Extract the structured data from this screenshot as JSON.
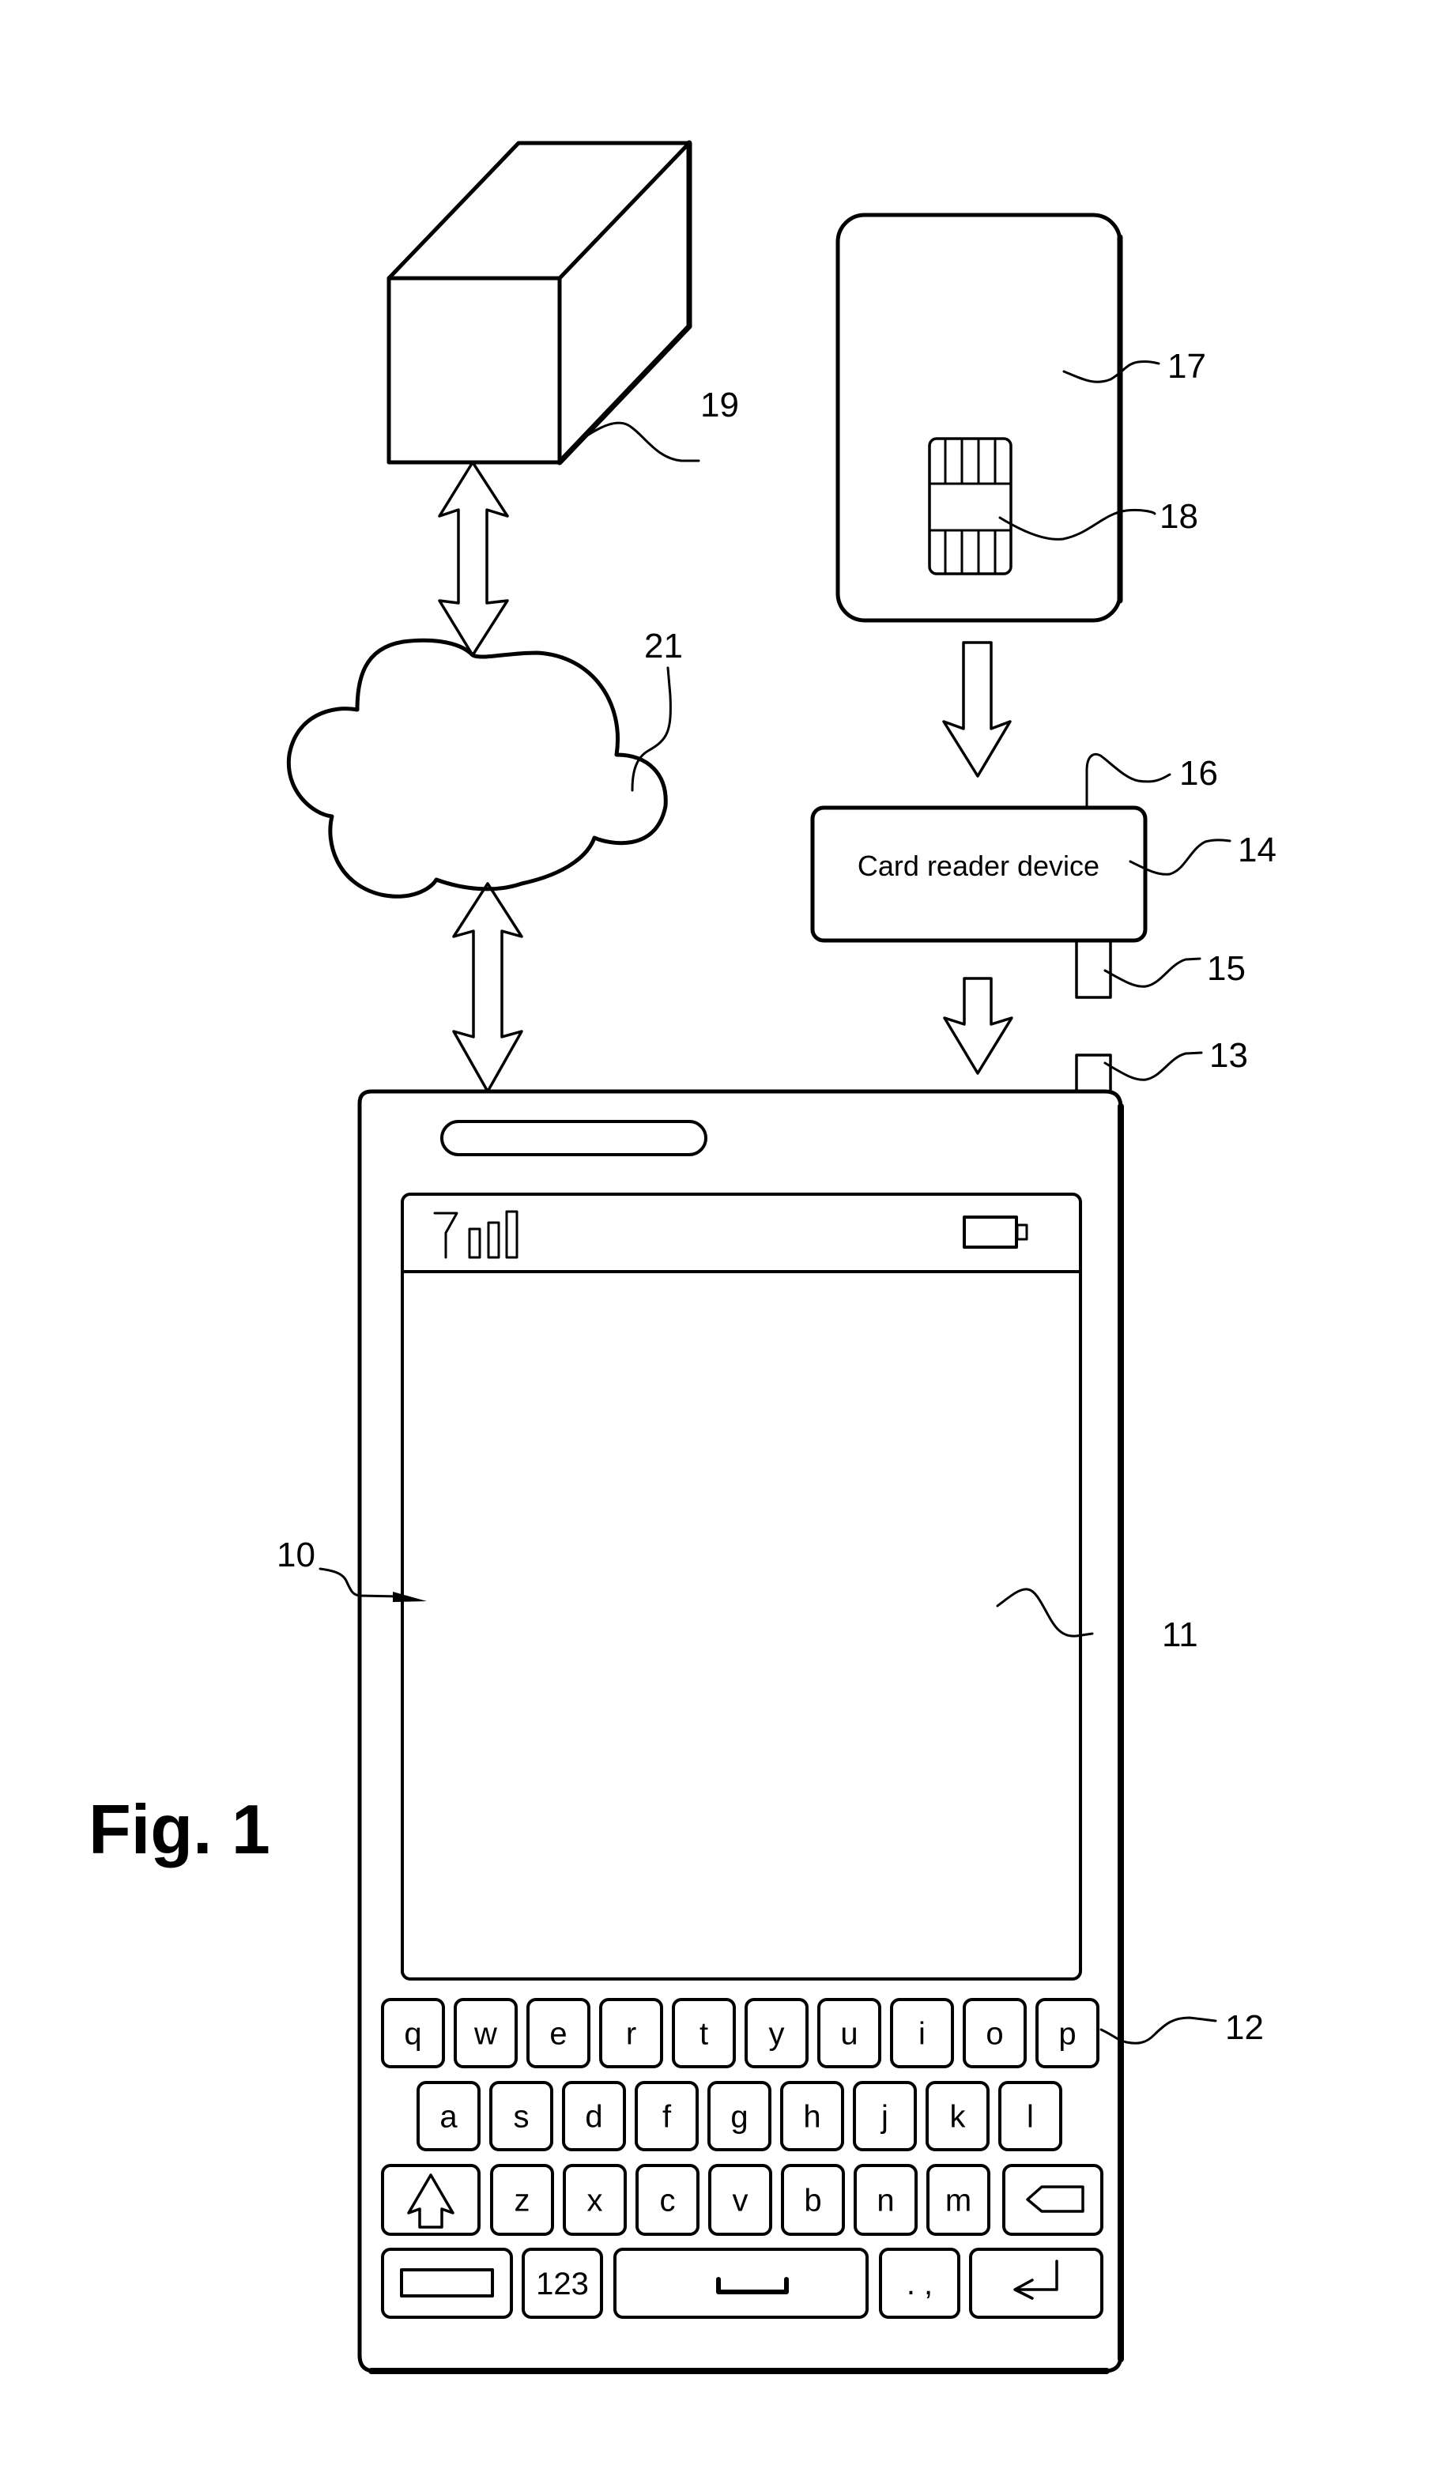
{
  "figure": {
    "title": "Fig. 1",
    "description": "Patent drawing: server, network cloud, chip card, card reader device and mobile phone with on-screen keyboard"
  },
  "components": {
    "server": {
      "ref": "19"
    },
    "network": {
      "ref": "21"
    },
    "chip_card": {
      "ref": "17"
    },
    "chip": {
      "ref": "18"
    },
    "card_reader": {
      "ref": "14",
      "label": "Card reader device"
    },
    "reader_antenna": {
      "ref": "16"
    },
    "reader_connector": {
      "ref": "15"
    },
    "phone_port": {
      "ref": "13"
    },
    "mobile_device": {
      "ref": "10"
    },
    "display": {
      "ref": "11"
    },
    "keyboard": {
      "ref": "12"
    }
  },
  "status_bar": {
    "signal_icon": "antenna-signal-icon",
    "signal_bars": 3,
    "battery_icon": "battery-icon"
  },
  "keyboard": {
    "row1": [
      "q",
      "w",
      "e",
      "r",
      "t",
      "y",
      "u",
      "i",
      "o",
      "p"
    ],
    "row2": [
      "a",
      "s",
      "d",
      "f",
      "g",
      "h",
      "j",
      "k",
      "l"
    ],
    "row3": [
      "z",
      "x",
      "c",
      "v",
      "b",
      "n",
      "m"
    ],
    "row3_left_icon": "shift-arrow-icon",
    "row3_right_icon": "backspace-icon",
    "row4": {
      "left_icon": "emoji-rectangle-icon",
      "numbers": "123",
      "space_icon": "space-bar-icon",
      "punct": ". ,",
      "enter_icon": "enter-return-icon"
    }
  }
}
